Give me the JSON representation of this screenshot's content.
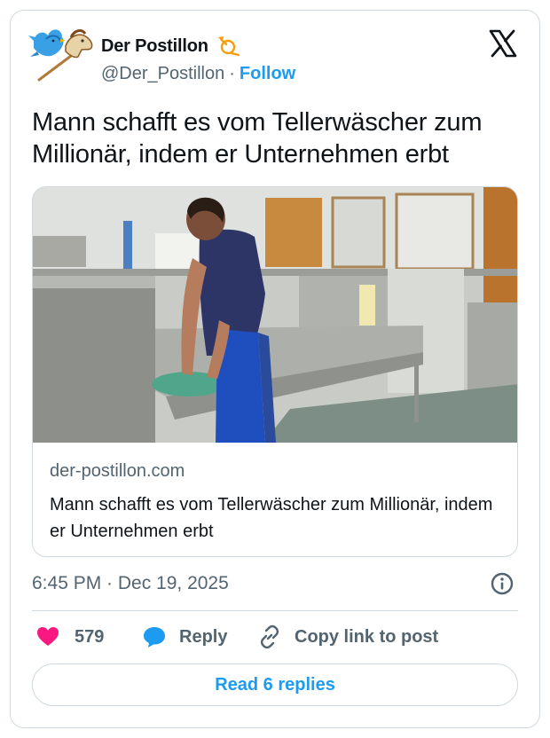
{
  "author": {
    "name": "Der Postillon",
    "handle": "@Der_Postillon",
    "separator": "·",
    "follow_label": "Follow"
  },
  "tweet": {
    "text": "Mann schafft es vom Tellerwäscher zum Millionär, indem er Unternehmen erbt"
  },
  "link_card": {
    "domain": "der-postillon.com",
    "title": "Mann schafft es vom Tellerwäscher zum Millionär, indem er Unternehmen erbt",
    "image_icon": "photo-man-washing-dishes"
  },
  "meta": {
    "timestamp": "6:45 PM · Dec 19, 2025"
  },
  "actions": {
    "like_count": "579",
    "reply_label": "Reply",
    "copy_label": "Copy link to post"
  },
  "read_replies_label": "Read 6 replies",
  "colors": {
    "accent": "#1d9bf0",
    "like": "#f91880",
    "text": "#0f1419",
    "muted": "#536471",
    "border": "#cfd9de"
  }
}
